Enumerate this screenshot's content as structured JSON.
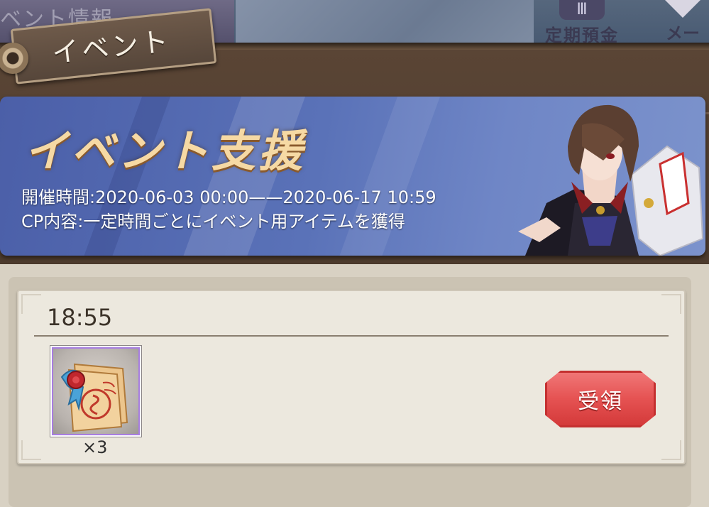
{
  "top_bar": {
    "left_tab_text": "ベント情報",
    "periodic_tab": {
      "icon": "iii-icon",
      "label": "定期預金"
    },
    "mail_tab": {
      "icon": "mail-icon",
      "label": "メー"
    }
  },
  "section_tag": {
    "label": "イベント"
  },
  "banner": {
    "title": "イベント支援",
    "period": "開催時間:2020-06-03 00:00——2020-06-17 10:59",
    "cp_content": "CP内容:一定時間ごとにイベント用アイテムを獲得"
  },
  "reward_card": {
    "time": "18:55",
    "item": {
      "icon": "sealed-scroll-icon",
      "quantity": "×3"
    },
    "claim_label": "受領"
  },
  "colors": {
    "banner_blue": "#5a72b8",
    "title_gold": "#f6d9a4",
    "claim_red": "#e55252",
    "item_border_purple": "#a77de0"
  }
}
